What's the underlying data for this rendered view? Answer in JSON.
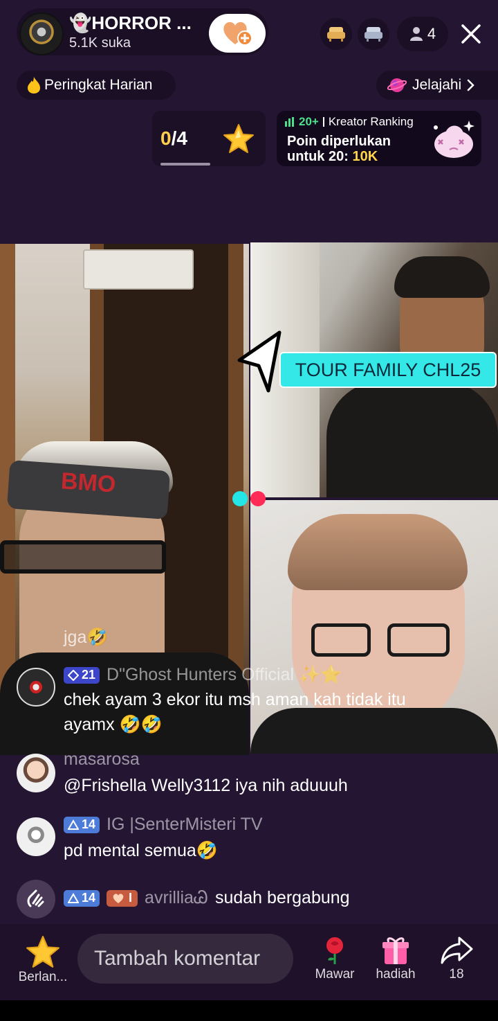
{
  "host": {
    "name": "👻HORROR ...",
    "likes": "5.1K suka",
    "follow_icon": "heart-plus-icon"
  },
  "top_right": {
    "viewer_count": "4",
    "icons": [
      "sofa-gold-icon",
      "sofa-silver-icon",
      "person-icon",
      "close-icon"
    ]
  },
  "daily_ranking": {
    "label": "Peringkat Harian"
  },
  "explore": {
    "label": "Jelajahi"
  },
  "goal": {
    "current": "0",
    "total": "/4",
    "progress_fraction": 0.0
  },
  "creator_rank": {
    "rank_text": "20+",
    "title": "Kreator Ranking",
    "line1": "Poin diperlukan",
    "line2_prefix": "untuk 20: ",
    "line2_value": "10K"
  },
  "tour_tag": "TOUR FAMILY CHL25",
  "chat": {
    "partial": "jga🤣",
    "messages": [
      {
        "level": "21",
        "name": "D\"Ghost Hunters Official ✨⭐",
        "text1": "chek ayam 3 ekor itu msh aman kah tidak itu",
        "text2": "ayamx 🤣🤣"
      },
      {
        "name": "masarosa",
        "text1": "@Frishella Welly3112 iya nih aduuuh"
      },
      {
        "level": "14",
        "name": "IG |SenterMisteri TV",
        "text1": "pd mental semua🤣"
      }
    ],
    "join": {
      "level": "14",
      "fan_level": "I",
      "name": "avrilliaᏊ",
      "action": "sudah bergabung"
    }
  },
  "bottom": {
    "left_label": "Berlan...",
    "comment_placeholder": "Tambah komentar",
    "rose_label": "Mawar",
    "gift_label": "hadiah",
    "share_count": "18"
  },
  "colors": {
    "background": "#241533",
    "accent_cyan": "#35e8e8",
    "accent_red": "#ff2a55",
    "gold": "#ffcf4b",
    "green": "#4be08a"
  }
}
